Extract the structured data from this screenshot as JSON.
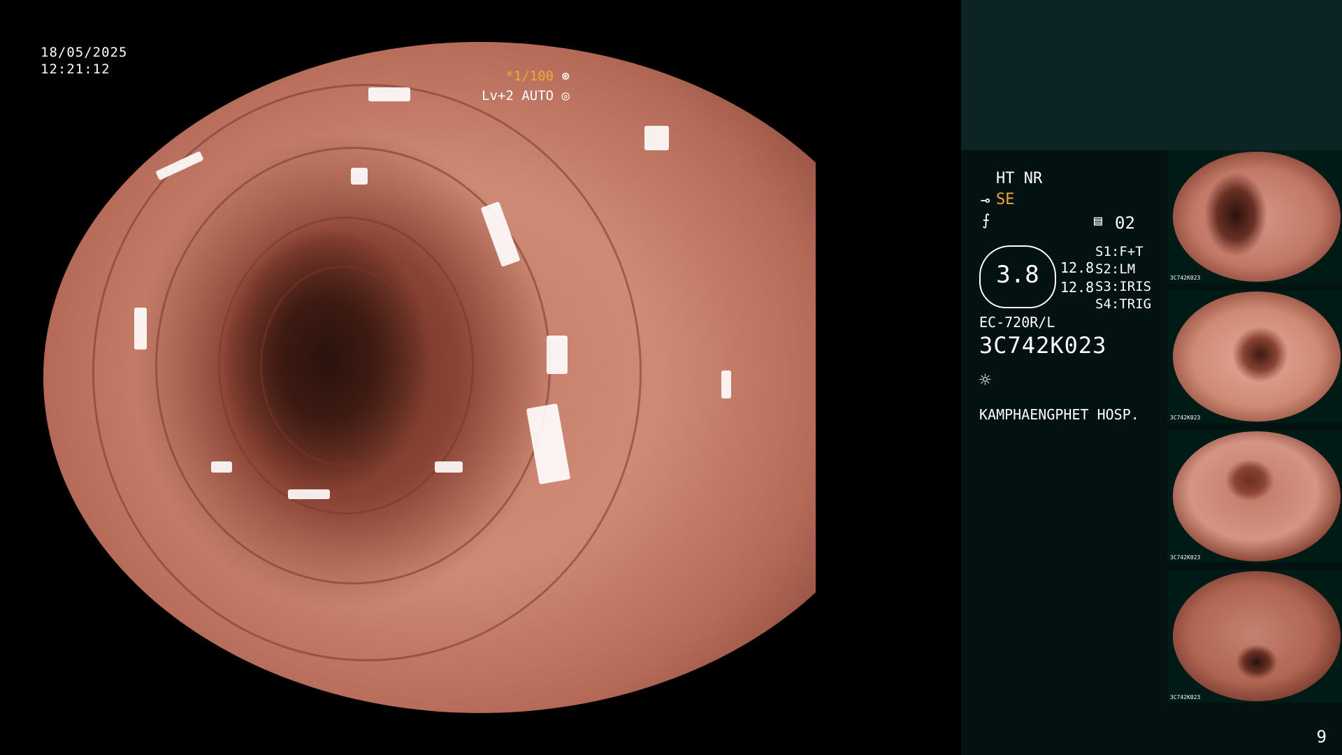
{
  "overlay": {
    "date": "18/05/2025",
    "time": "12:21:12",
    "zoom": "*1/100",
    "level": "Lv+2 AUTO"
  },
  "info_panel": {
    "enhancement": "HT NR",
    "mode": "SE",
    "memory_label": "02",
    "gauge_value": "3.8",
    "values": [
      "12.8",
      "12.8"
    ],
    "switch_labels": [
      "S1:F+T",
      "S2:LM",
      "S3:IRIS",
      "S4:TRIG"
    ],
    "scope_model": "EC-720R/L",
    "serial": "3C742K023",
    "hospital": "KAMPHAENGPHET HOSP."
  },
  "thumbnails": [
    {
      "label": "3C742K023"
    },
    {
      "label": "3C742K023"
    },
    {
      "label": "3C742K023"
    },
    {
      "label": "3C742K023"
    }
  ],
  "page_number": "9",
  "icons": [
    "shutter-icon",
    "aperture-icon",
    "scope-icon",
    "freeze-icon",
    "memory-icon",
    "light-icon"
  ],
  "colors": {
    "accent": "#f0a830",
    "panel_bg": "#031210",
    "panel_top": "#0c2423"
  }
}
